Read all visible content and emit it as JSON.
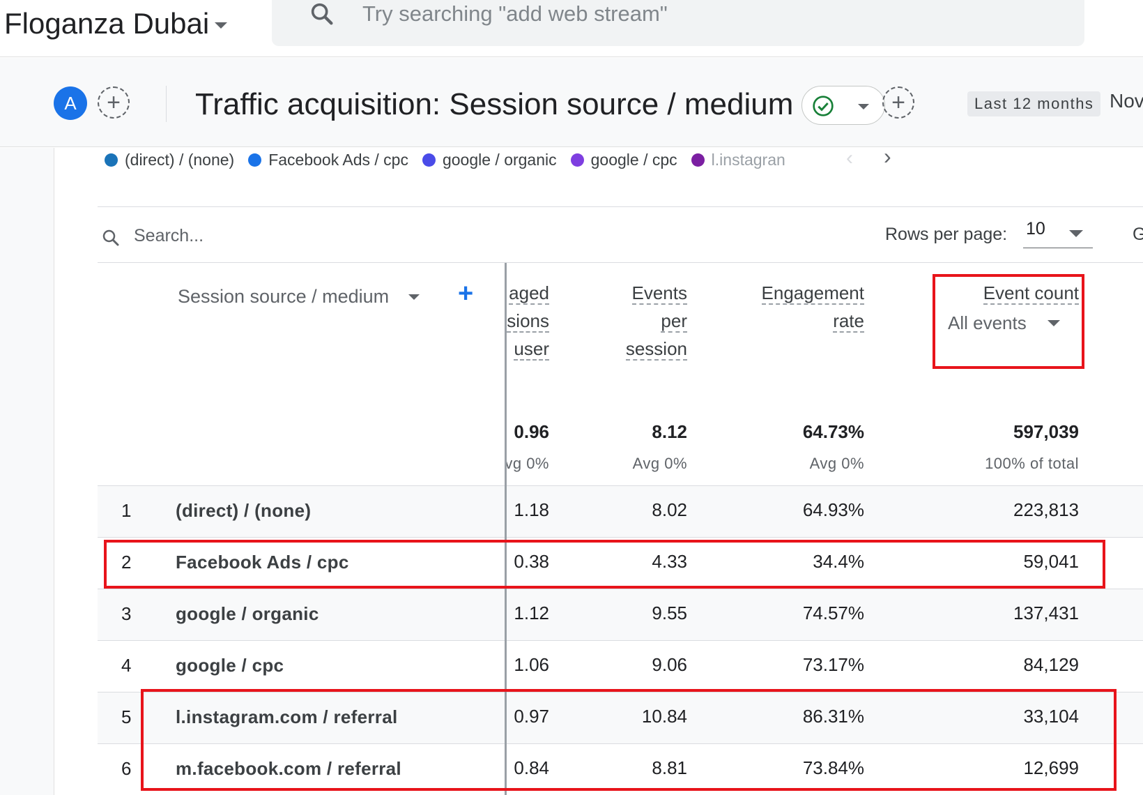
{
  "topbar": {
    "account_name": "Floganza Dubai",
    "search_placeholder": "Try searching \"add web stream\""
  },
  "report": {
    "avatar_letter": "A",
    "title": "Traffic acquisition: Session source / medium",
    "date_label": "Last 12 months",
    "date_range": "Nov"
  },
  "legend": [
    {
      "label": "(direct) / (none)",
      "color": "#1a73b8"
    },
    {
      "label": "Facebook Ads / cpc",
      "color": "#1a73e8"
    },
    {
      "label": "google / organic",
      "color": "#4a4be8"
    },
    {
      "label": "google / cpc",
      "color": "#7e3ee0"
    },
    {
      "label": "l.instagran",
      "color": "#7b1fa2"
    }
  ],
  "table": {
    "search_placeholder": "Search...",
    "rows_per_page_label": "Rows per page:",
    "rows_per_page_value": "10",
    "goto_label": "G",
    "dimension_header": "Session source / medium",
    "columns": [
      {
        "lines": [
          "aged",
          "sions",
          "user"
        ],
        "total": "0.96",
        "sub": "vg 0%"
      },
      {
        "lines": [
          "Events",
          "per",
          "session"
        ],
        "total": "8.12",
        "sub": "Avg 0%"
      },
      {
        "lines": [
          "Engagement",
          "rate"
        ],
        "total": "64.73%",
        "sub": "Avg 0%"
      },
      {
        "lines": [
          "Event count"
        ],
        "total": "597,039",
        "sub": "100% of total",
        "selector": "All events"
      }
    ],
    "rows": [
      {
        "index": "1",
        "dimension": "(direct) / (none)",
        "values": [
          "1.18",
          "8.02",
          "64.93%",
          "223,813"
        ]
      },
      {
        "index": "2",
        "dimension": "Facebook Ads / cpc",
        "values": [
          "0.38",
          "4.33",
          "34.4%",
          "59,041"
        ]
      },
      {
        "index": "3",
        "dimension": "google / organic",
        "values": [
          "1.12",
          "9.55",
          "74.57%",
          "137,431"
        ]
      },
      {
        "index": "4",
        "dimension": "google / cpc",
        "values": [
          "1.06",
          "9.06",
          "73.17%",
          "84,129"
        ]
      },
      {
        "index": "5",
        "dimension": "l.instagram.com / referral",
        "values": [
          "0.97",
          "10.84",
          "86.31%",
          "33,104"
        ]
      },
      {
        "index": "6",
        "dimension": "m.facebook.com / referral",
        "values": [
          "0.84",
          "8.81",
          "73.84%",
          "12,699"
        ]
      }
    ]
  },
  "colors": {
    "accent": "#1a73e8",
    "highlight": "#e8141b",
    "success": "#188038"
  }
}
